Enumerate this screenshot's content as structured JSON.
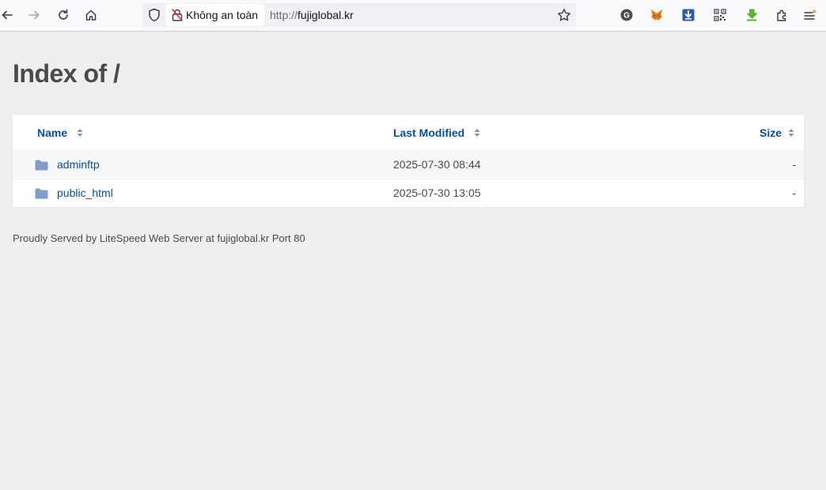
{
  "browser": {
    "security_label": "Không an toàn",
    "url_scheme": "http://",
    "url_host": "fujiglobal.kr",
    "toolbar_icons": [
      "back-icon",
      "forward-icon",
      "reload-icon",
      "home-icon",
      "shield-icon",
      "insecure-lock-icon",
      "bookmark-star-icon",
      "grammarly-icon",
      "metamask-icon",
      "download-extension-icon",
      "qr-code-icon",
      "green-download-icon",
      "extensions-icon",
      "menu-icon"
    ]
  },
  "page": {
    "title": "Index of /",
    "columns": {
      "name": "Name",
      "modified": "Last Modified",
      "size": "Size"
    },
    "rows": [
      {
        "name": "adminftp",
        "modified": "2025-07-30 08:44",
        "size": "-"
      },
      {
        "name": "public_html",
        "modified": "2025-07-30 13:05",
        "size": "-"
      }
    ],
    "footer": "Proudly Served by LiteSpeed Web Server at fujiglobal.kr Port 80"
  },
  "colors": {
    "link": "#0b4e96",
    "folder": "#7f9dc8",
    "page_bg": "#eeeff1"
  }
}
